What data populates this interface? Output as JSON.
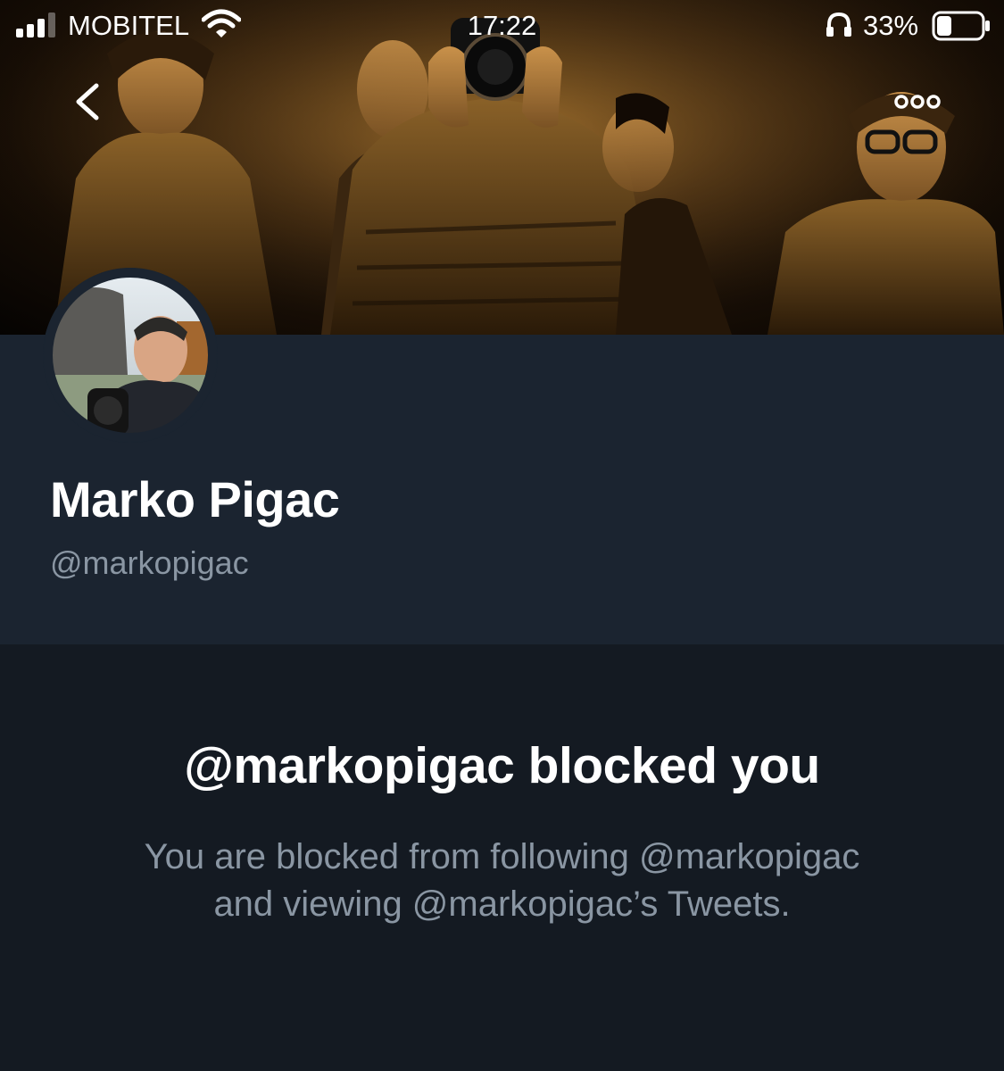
{
  "status_bar": {
    "carrier": "MOBITEL",
    "time": "17:22",
    "battery_percent": "33%",
    "battery_level": 0.33,
    "icons": [
      "signal-icon",
      "wifi-icon",
      "headphones-icon",
      "battery-icon"
    ]
  },
  "nav": {
    "back_icon": "chevron-left-icon",
    "more_icon": "more-dots-icon"
  },
  "profile": {
    "display_name": "Marko Pigac",
    "handle": "@markopigac"
  },
  "blocked": {
    "title": "@markopigac blocked you",
    "line1": "You are blocked from following @markopigac",
    "line2": "and viewing @markopigac’s Tweets."
  },
  "colors": {
    "profile_background": "#1b2430",
    "page_background": "#141a22",
    "secondary_text": "#8a96a3",
    "banner_tone": "#6a4a1c"
  }
}
